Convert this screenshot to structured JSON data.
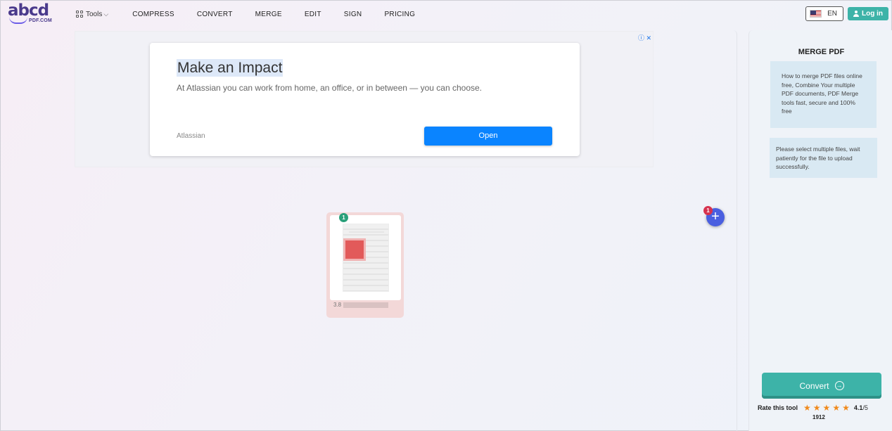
{
  "header": {
    "logo_text": "abcd",
    "logo_sub": "PDF.COM",
    "tools_label": "Tools",
    "nav": [
      "COMPRESS",
      "CONVERT",
      "MERGE",
      "EDIT",
      "SIGN",
      "PRICING"
    ],
    "lang_label": "EN",
    "login_label": "Log in"
  },
  "ad": {
    "close_glyphs": "ⓘ ✕",
    "title": "Make an Impact",
    "description": "At Atlassian you can work from home, an office, or in between — you can choose.",
    "brand": "Atlassian",
    "open_label": "Open"
  },
  "files": {
    "badge": "1",
    "name_prefix": "3.8",
    "add_badge": "1",
    "add_symbol": "+"
  },
  "sidebar": {
    "title": "MERGE PDF",
    "info_1": "How to merge PDF files online free, Combine Your multiple PDF documents, PDF Merge tools fast, secure and 100% free",
    "info_2": "Please select multiple files, wait patiently for the file to upload successfully.",
    "convert_label": "Convert",
    "rate_label": "Rate this tool",
    "rating": "4.1",
    "rating_max": "/5",
    "rating_count": "1912",
    "stars": [
      "★",
      "★",
      "★",
      "★",
      "★"
    ]
  },
  "colors": {
    "accent": "#3db3a8",
    "ad_button": "#0a84ff",
    "add_button": "#4a5fe0",
    "star": "#f08a1c"
  }
}
